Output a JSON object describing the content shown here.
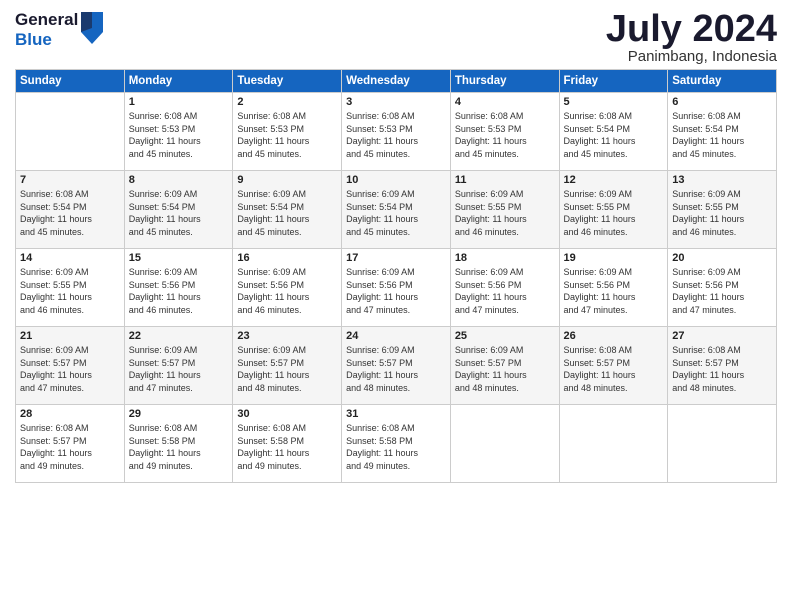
{
  "header": {
    "logo_line1": "General",
    "logo_line2": "Blue",
    "month_year": "July 2024",
    "location": "Panimbang, Indonesia"
  },
  "days_of_week": [
    "Sunday",
    "Monday",
    "Tuesday",
    "Wednesday",
    "Thursday",
    "Friday",
    "Saturday"
  ],
  "weeks": [
    [
      {
        "day": "",
        "info": ""
      },
      {
        "day": "1",
        "info": "Sunrise: 6:08 AM\nSunset: 5:53 PM\nDaylight: 11 hours\nand 45 minutes."
      },
      {
        "day": "2",
        "info": "Sunrise: 6:08 AM\nSunset: 5:53 PM\nDaylight: 11 hours\nand 45 minutes."
      },
      {
        "day": "3",
        "info": "Sunrise: 6:08 AM\nSunset: 5:53 PM\nDaylight: 11 hours\nand 45 minutes."
      },
      {
        "day": "4",
        "info": "Sunrise: 6:08 AM\nSunset: 5:53 PM\nDaylight: 11 hours\nand 45 minutes."
      },
      {
        "day": "5",
        "info": "Sunrise: 6:08 AM\nSunset: 5:54 PM\nDaylight: 11 hours\nand 45 minutes."
      },
      {
        "day": "6",
        "info": "Sunrise: 6:08 AM\nSunset: 5:54 PM\nDaylight: 11 hours\nand 45 minutes."
      }
    ],
    [
      {
        "day": "7",
        "info": "Sunrise: 6:08 AM\nSunset: 5:54 PM\nDaylight: 11 hours\nand 45 minutes."
      },
      {
        "day": "8",
        "info": "Sunrise: 6:09 AM\nSunset: 5:54 PM\nDaylight: 11 hours\nand 45 minutes."
      },
      {
        "day": "9",
        "info": "Sunrise: 6:09 AM\nSunset: 5:54 PM\nDaylight: 11 hours\nand 45 minutes."
      },
      {
        "day": "10",
        "info": "Sunrise: 6:09 AM\nSunset: 5:54 PM\nDaylight: 11 hours\nand 45 minutes."
      },
      {
        "day": "11",
        "info": "Sunrise: 6:09 AM\nSunset: 5:55 PM\nDaylight: 11 hours\nand 46 minutes."
      },
      {
        "day": "12",
        "info": "Sunrise: 6:09 AM\nSunset: 5:55 PM\nDaylight: 11 hours\nand 46 minutes."
      },
      {
        "day": "13",
        "info": "Sunrise: 6:09 AM\nSunset: 5:55 PM\nDaylight: 11 hours\nand 46 minutes."
      }
    ],
    [
      {
        "day": "14",
        "info": "Sunrise: 6:09 AM\nSunset: 5:55 PM\nDaylight: 11 hours\nand 46 minutes."
      },
      {
        "day": "15",
        "info": "Sunrise: 6:09 AM\nSunset: 5:56 PM\nDaylight: 11 hours\nand 46 minutes."
      },
      {
        "day": "16",
        "info": "Sunrise: 6:09 AM\nSunset: 5:56 PM\nDaylight: 11 hours\nand 46 minutes."
      },
      {
        "day": "17",
        "info": "Sunrise: 6:09 AM\nSunset: 5:56 PM\nDaylight: 11 hours\nand 47 minutes."
      },
      {
        "day": "18",
        "info": "Sunrise: 6:09 AM\nSunset: 5:56 PM\nDaylight: 11 hours\nand 47 minutes."
      },
      {
        "day": "19",
        "info": "Sunrise: 6:09 AM\nSunset: 5:56 PM\nDaylight: 11 hours\nand 47 minutes."
      },
      {
        "day": "20",
        "info": "Sunrise: 6:09 AM\nSunset: 5:56 PM\nDaylight: 11 hours\nand 47 minutes."
      }
    ],
    [
      {
        "day": "21",
        "info": "Sunrise: 6:09 AM\nSunset: 5:57 PM\nDaylight: 11 hours\nand 47 minutes."
      },
      {
        "day": "22",
        "info": "Sunrise: 6:09 AM\nSunset: 5:57 PM\nDaylight: 11 hours\nand 47 minutes."
      },
      {
        "day": "23",
        "info": "Sunrise: 6:09 AM\nSunset: 5:57 PM\nDaylight: 11 hours\nand 48 minutes."
      },
      {
        "day": "24",
        "info": "Sunrise: 6:09 AM\nSunset: 5:57 PM\nDaylight: 11 hours\nand 48 minutes."
      },
      {
        "day": "25",
        "info": "Sunrise: 6:09 AM\nSunset: 5:57 PM\nDaylight: 11 hours\nand 48 minutes."
      },
      {
        "day": "26",
        "info": "Sunrise: 6:08 AM\nSunset: 5:57 PM\nDaylight: 11 hours\nand 48 minutes."
      },
      {
        "day": "27",
        "info": "Sunrise: 6:08 AM\nSunset: 5:57 PM\nDaylight: 11 hours\nand 48 minutes."
      }
    ],
    [
      {
        "day": "28",
        "info": "Sunrise: 6:08 AM\nSunset: 5:57 PM\nDaylight: 11 hours\nand 49 minutes."
      },
      {
        "day": "29",
        "info": "Sunrise: 6:08 AM\nSunset: 5:58 PM\nDaylight: 11 hours\nand 49 minutes."
      },
      {
        "day": "30",
        "info": "Sunrise: 6:08 AM\nSunset: 5:58 PM\nDaylight: 11 hours\nand 49 minutes."
      },
      {
        "day": "31",
        "info": "Sunrise: 6:08 AM\nSunset: 5:58 PM\nDaylight: 11 hours\nand 49 minutes."
      },
      {
        "day": "",
        "info": ""
      },
      {
        "day": "",
        "info": ""
      },
      {
        "day": "",
        "info": ""
      }
    ]
  ]
}
